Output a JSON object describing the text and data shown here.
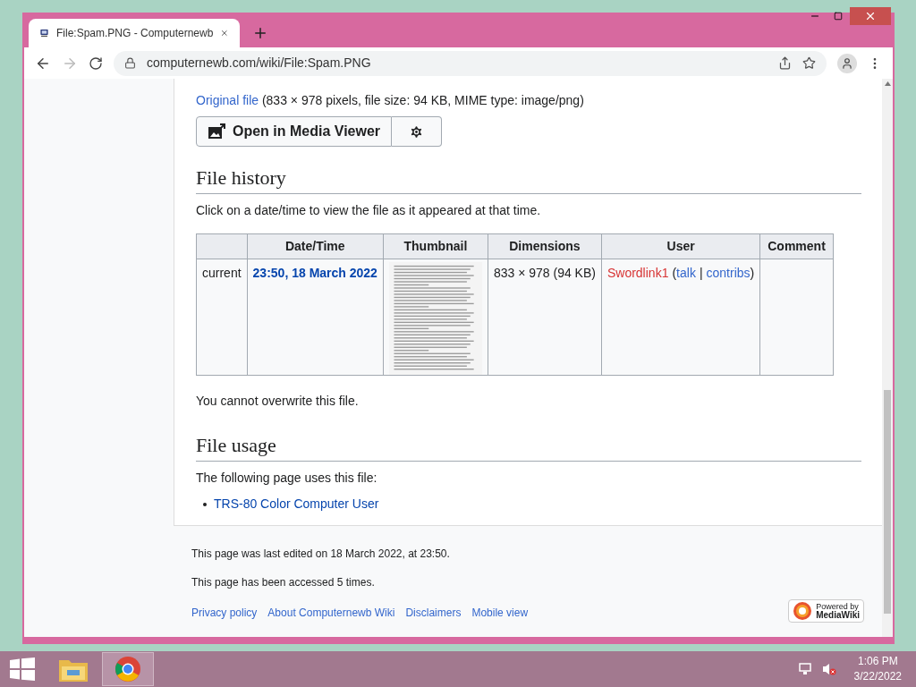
{
  "browser": {
    "tab_title": "File:Spam.PNG - Computernewb",
    "url": "computernewb.com/wiki/File:Spam.PNG"
  },
  "original_file": {
    "link": "Original file",
    "text": " (833 × 978 pixels, file size: 94 KB, MIME type: image/png)"
  },
  "media_viewer": {
    "label": "Open in Media Viewer"
  },
  "file_history": {
    "heading": "File history",
    "intro": "Click on a date/time to view the file as it appeared at that time.",
    "columns": [
      "",
      "Date/Time",
      "Thumbnail",
      "Dimensions",
      "User",
      "Comment"
    ],
    "rows": [
      {
        "version": "current",
        "datetime": "23:50, 18 March 2022",
        "dimensions": "833 × 978 (94 KB)",
        "user": [
          {
            "kind": "redlink",
            "text": "Swordlink1"
          },
          {
            "kind": "plain",
            "text": "("
          },
          {
            "kind": "link",
            "text": "talk"
          },
          {
            "kind": "plain",
            "text": "|"
          },
          {
            "kind": "link",
            "text": "contribs"
          },
          {
            "kind": "plain",
            "text": ")"
          }
        ]
      }
    ],
    "note": "You cannot overwrite this file."
  },
  "file_usage": {
    "heading": "File usage",
    "intro": "The following page uses this file:",
    "links": [
      "TRS-80 Color Computer User"
    ]
  },
  "footer": {
    "lines": [
      "This page was last edited on 18 March 2022, at 23:50.",
      "This page has been accessed 5 times."
    ],
    "links": [
      "Privacy policy",
      "About Computernewb Wiki",
      "Disclaimers",
      "Mobile view"
    ],
    "powered_by": [
      "Powered by",
      "MediaWiki"
    ]
  },
  "taskbar": {
    "time": "1:06 PM",
    "date": "3/22/2022"
  }
}
